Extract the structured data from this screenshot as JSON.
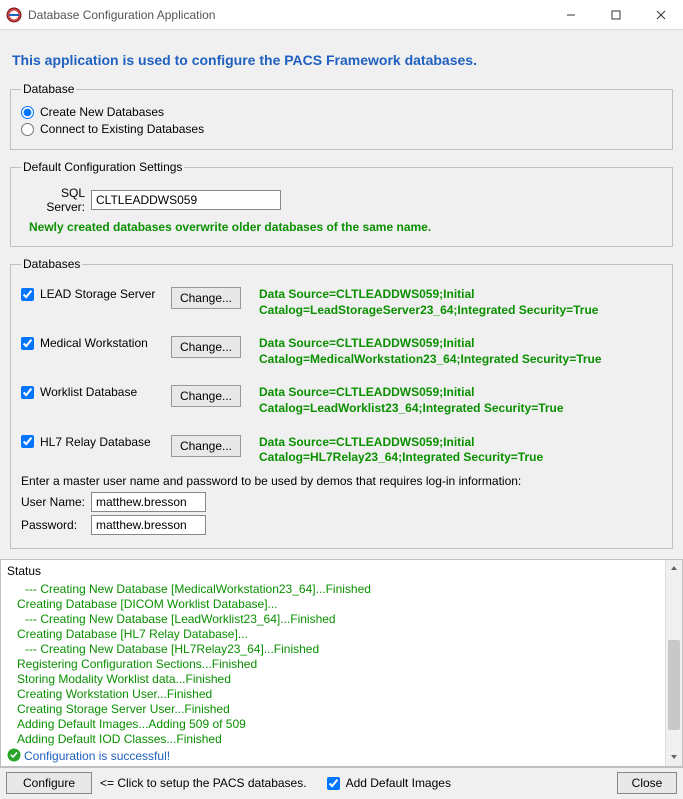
{
  "window": {
    "title": "Database Configuration Application"
  },
  "intro": "This application is used to configure the PACS Framework databases.",
  "database_group": {
    "legend": "Database",
    "create_label": "Create New Databases",
    "connect_label": "Connect to Existing Databases",
    "selected": "create"
  },
  "defaults_group": {
    "legend": "Default Configuration Settings",
    "sql_label": "SQL Server:",
    "sql_value": "CLTLEADDWS059",
    "overwrite_note": "Newly created databases overwrite older databases of the same name."
  },
  "databases_group": {
    "legend": "Databases",
    "change_label": "Change...",
    "items": [
      {
        "label": "LEAD Storage Server",
        "checked": true,
        "conn": "Data Source=CLTLEADDWS059;Initial Catalog=LeadStorageServer23_64;Integrated Security=True"
      },
      {
        "label": "Medical Workstation",
        "checked": true,
        "conn": "Data Source=CLTLEADDWS059;Initial Catalog=MedicalWorkstation23_64;Integrated Security=True"
      },
      {
        "label": "Worklist Database",
        "checked": true,
        "conn": "Data Source=CLTLEADDWS059;Initial Catalog=LeadWorklist23_64;Integrated Security=True"
      },
      {
        "label": "HL7 Relay Database",
        "checked": true,
        "conn": "Data Source=CLTLEADDWS059;Initial Catalog=HL7Relay23_64;Integrated Security=True"
      }
    ],
    "master_note": "Enter a master user name and password to be used by demos that requires log-in information:",
    "username_label": "User Name:",
    "username_value": "matthew.bresson",
    "password_label": "Password:",
    "password_value": "matthew.bresson"
  },
  "status": {
    "legend": "Status",
    "lines": [
      {
        "text": "--- Creating New Database [MedicalWorkstation23_64]...Finished",
        "indent": true
      },
      {
        "text": "Creating Database [DICOM Worklist Database]...",
        "indent": false
      },
      {
        "text": "--- Creating New Database [LeadWorklist23_64]...Finished",
        "indent": true
      },
      {
        "text": "Creating Database [HL7 Relay Database]...",
        "indent": false
      },
      {
        "text": "--- Creating New Database [HL7Relay23_64]...Finished",
        "indent": true
      },
      {
        "text": "Registering Configuration Sections...Finished",
        "indent": false
      },
      {
        "text": "Storing Modality Worklist data...Finished",
        "indent": false
      },
      {
        "text": "Creating Workstation User...Finished",
        "indent": false
      },
      {
        "text": "Creating Storage Server User...Finished",
        "indent": false
      },
      {
        "text": "Adding Default Images...Adding 509 of 509",
        "indent": false
      },
      {
        "text": "Adding Default IOD Classes...Finished",
        "indent": false
      }
    ],
    "success": "Configuration is successful!"
  },
  "bottom": {
    "configure_label": "Configure",
    "hint": "<= Click to setup the PACS databases.",
    "add_images_label": "Add Default Images",
    "add_images_checked": true,
    "close_label": "Close"
  }
}
